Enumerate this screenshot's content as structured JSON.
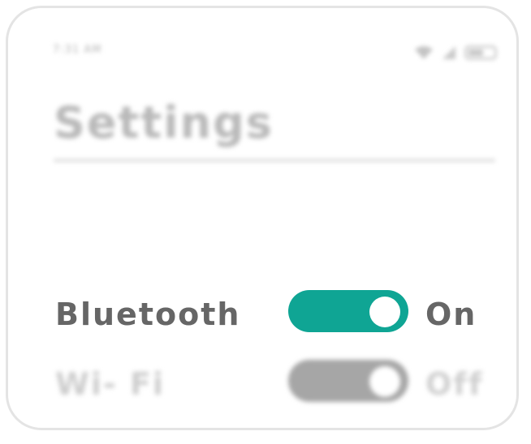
{
  "status_bar": {
    "time": "7:31 AM",
    "icons": [
      "wifi-icon",
      "signal-icon",
      "battery-icon"
    ]
  },
  "page": {
    "title": "Settings"
  },
  "settings": [
    {
      "label": "Bluetooth",
      "state": "On",
      "enabled": true,
      "color": "#0fa594"
    },
    {
      "label": "Wi- Fi",
      "state": "Off",
      "enabled": false,
      "color": "#a6a6a6"
    }
  ],
  "colors": {
    "accent": "#0fa594",
    "label_text": "#666666",
    "frame_border": "#e4e4e4"
  }
}
